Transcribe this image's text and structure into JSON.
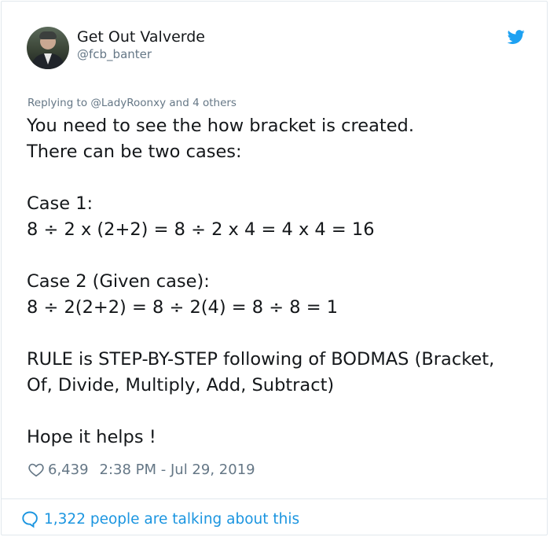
{
  "author": {
    "display_name": "Get Out Valverde",
    "handle": "@fcb_banter"
  },
  "replying": {
    "prefix": "Replying to",
    "mention": "@LadyRoonxy",
    "suffix": "and 4 others"
  },
  "tweet": {
    "lines": [
      "You need to see the how bracket is created.",
      "There can be two cases:",
      "",
      "Case 1:",
      "8 ÷ 2 x (2+2) = 8 ÷ 2 x 4 = 4 x 4 = 16",
      "",
      "Case 2 (Given case):",
      "8 ÷ 2(2+2) = 8 ÷ 2(4) = 8 ÷ 8 = 1",
      "",
      "RULE is STEP-BY-STEP following of BODMAS (Bracket,",
      "Of, Divide, Multiply, Add, Subtract)",
      "",
      "Hope it helps !"
    ]
  },
  "meta": {
    "likes": "6,439",
    "timestamp": "2:38 PM - Jul 29, 2019"
  },
  "footer": {
    "talking": "1,322 people are talking about this"
  },
  "icons": {
    "brand": "twitter-bird-icon",
    "like": "heart-icon",
    "reply": "speech-bubble-icon"
  },
  "colors": {
    "brand_blue": "#1da1f2",
    "link_blue": "#1b95e0",
    "text": "#14171a",
    "muted": "#657786"
  }
}
